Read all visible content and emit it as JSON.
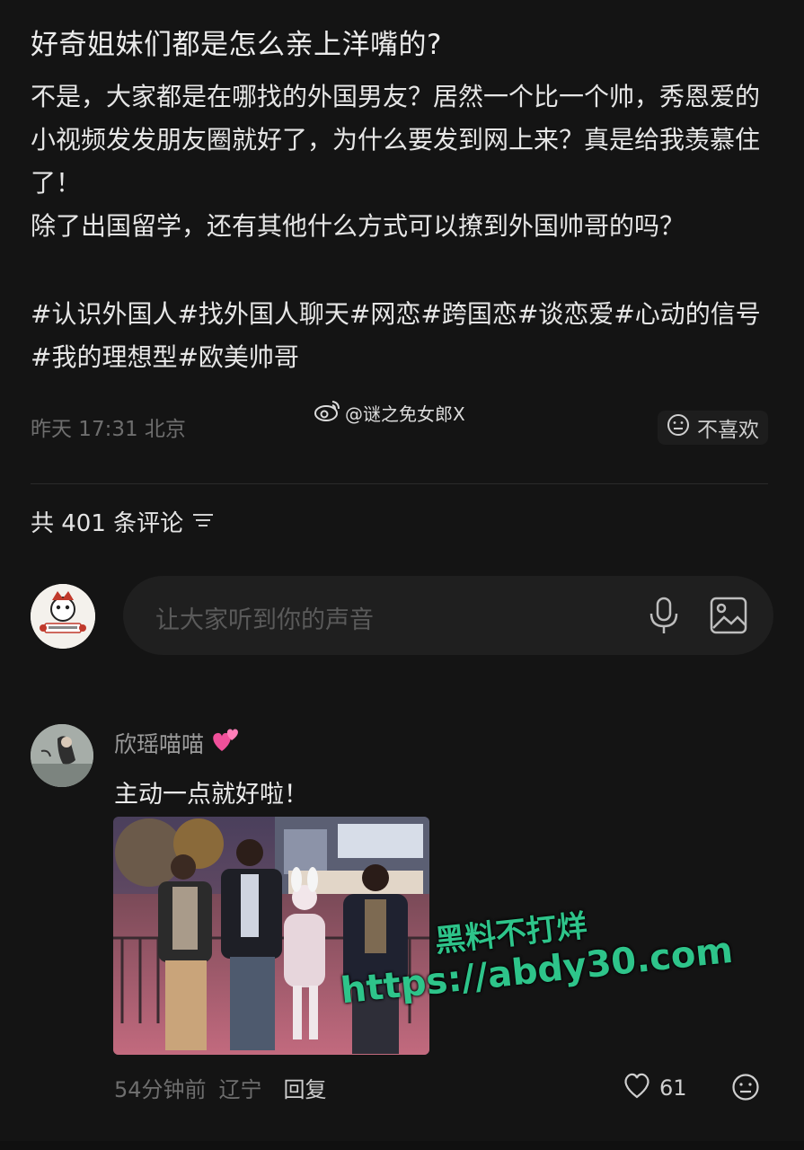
{
  "post": {
    "title": "好奇姐妹们都是怎么亲上洋嘴的?",
    "body_lines": [
      "不是，大家都是在哪找的外国男友？居然一个比一个帅，秀恩爱的小视频发发朋友圈就好了，为什么要发到网上来？真是给我羡慕住了！",
      "除了出国留学，还有其他什么方式可以撩到外国帅哥的吗？"
    ],
    "tags": "#认识外国人#找外国人聊天#网恋#跨国恋#谈恋爱#心动的信号#我的理想型#欧美帅哥",
    "meta": "昨天 17:31 北京",
    "dislike_label": "不喜欢"
  },
  "watermark": {
    "weibo_handle": "@谜之免女郎X",
    "overlay_line1": "黑料不打烊",
    "overlay_line2": "https://abdy30.com"
  },
  "comments": {
    "header": "共 401 条评论",
    "input_placeholder": "让大家听到你的声音",
    "items": [
      {
        "author": "欣瑶喵喵",
        "text": "主动一点就好啦！",
        "time": "54分钟前",
        "location": "辽宁",
        "reply_label": "回复",
        "likes": "61"
      }
    ]
  },
  "colors": {
    "background": "#141414",
    "watermark_green": "#2ec48a"
  }
}
